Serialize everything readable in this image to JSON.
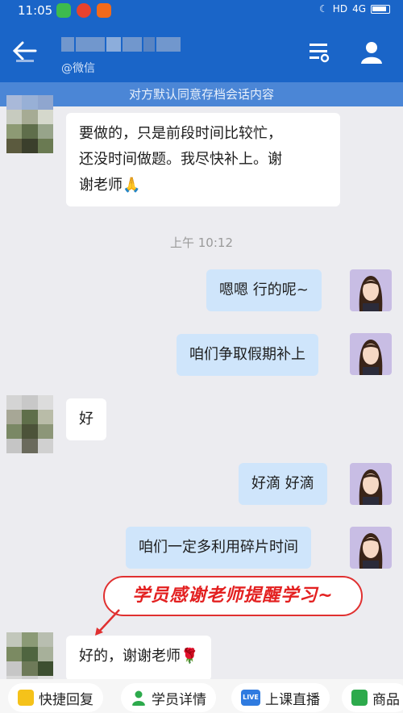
{
  "status": {
    "time": "11:05",
    "network": "4G",
    "hd": "HD"
  },
  "header": {
    "subtitle": "@微信"
  },
  "notice": "对方默认同意存档会话内容",
  "messages": {
    "m1": "要做的，只是前段时间比较忙，",
    "m1b": "还没时间做题。我尽快补上。谢",
    "m1c": "谢老师🙏",
    "time1": "上午 10:12",
    "m2": "嗯嗯 行的呢~",
    "m3": "咱们争取假期补上",
    "m4": "好",
    "m5": "好滴 好滴",
    "m6": "咱们一定多利用碎片时间",
    "m7": "好的，谢谢老师🌹"
  },
  "callout": "学员感谢老师提醒学习~",
  "bottom": {
    "quick_reply": "快捷回复",
    "student_details": "学员详情",
    "live": "上课直播",
    "live_badge": "LIVE",
    "goods": "商品"
  },
  "colors": {
    "primary": "#1a65c8",
    "out_bubble": "#cfe5fb",
    "callout_red": "#e03030"
  }
}
